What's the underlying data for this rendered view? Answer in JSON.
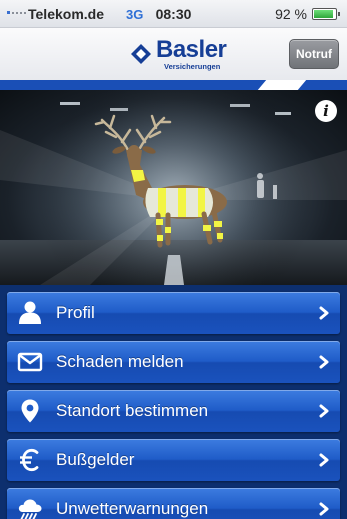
{
  "status_bar": {
    "carrier": "Telekom.de",
    "network": "3G",
    "time": "08:30",
    "battery": "92 %",
    "battery_level": 0.92
  },
  "header": {
    "logo_name": "Basler",
    "logo_sub": "Versicherungen",
    "notruf_label": "Notruf",
    "brand_color": "#163e96"
  },
  "hero": {
    "info_glyph": "i"
  },
  "menu": {
    "items": [
      {
        "label": "Profil",
        "icon": "person-icon"
      },
      {
        "label": "Schaden melden",
        "icon": "envelope-icon"
      },
      {
        "label": "Standort bestimmen",
        "icon": "location-pin-icon"
      },
      {
        "label": "Bußgelder",
        "icon": "euro-icon"
      },
      {
        "label": "Unwetterwarnungen",
        "icon": "storm-cloud-icon"
      }
    ],
    "accent": "#1f5cc8"
  }
}
